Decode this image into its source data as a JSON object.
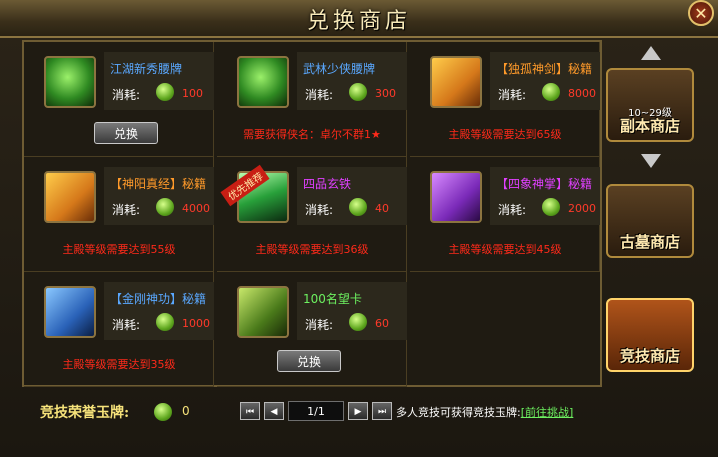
{
  "window": {
    "title": "兑换商店",
    "close_label": "✕"
  },
  "cost_label": "消耗:",
  "items": [
    {
      "name": "江湖新秀腰牌",
      "name_color": "#5aa8ff",
      "cost": "100",
      "requirement": "",
      "button": "兑换",
      "icon": "jade-waist-token-icon"
    },
    {
      "name": "武林少侠腰牌",
      "name_color": "#5aa8ff",
      "cost": "300",
      "requirement": "需要获得侠名：卓尔不群1★",
      "button": "",
      "icon": "jade-waist-token-icon"
    },
    {
      "name": "【独孤神剑】秘籍",
      "name_color": "#ff9a2a",
      "cost": "8000",
      "requirement": "主殿等级需要达到65级",
      "button": "",
      "icon": "orange-book-icon"
    },
    {
      "name": "【神阳真经】秘籍",
      "name_color": "#ff9a2a",
      "cost": "4000",
      "requirement": "主殿等级需要达到55级",
      "button": "",
      "icon": "orange-book-icon"
    },
    {
      "name": "四品玄铁",
      "name_color": "#e040ff",
      "cost": "40",
      "requirement": "主殿等级需要达到36级",
      "button": "",
      "icon": "green-crystal-icon",
      "badge": "优先推荐"
    },
    {
      "name": "【四象神掌】秘籍",
      "name_color": "#e040ff",
      "cost": "2000",
      "requirement": "主殿等级需要达到45级",
      "button": "",
      "icon": "purple-book-icon"
    },
    {
      "name": "【金刚神功】秘籍",
      "name_color": "#5aa8ff",
      "cost": "1000",
      "requirement": "主殿等级需要达到35级",
      "button": "",
      "icon": "blue-book-icon"
    },
    {
      "name": "100名望卡",
      "name_color": "#6df060",
      "cost": "60",
      "requirement": "",
      "button": "兑换",
      "icon": "fame-card-icon"
    }
  ],
  "tabs": [
    {
      "label": "副本商店",
      "sub": "10~29级"
    },
    {
      "label": "古墓商店",
      "sub": ""
    },
    {
      "label": "竞技商店",
      "sub": ""
    }
  ],
  "footer": {
    "honor_label": "竞技荣誉玉牌:",
    "honor_value": "0",
    "page": "1/1",
    "first": "⏮",
    "prev": "◀",
    "next": "▶",
    "last": "⏭",
    "hint": "多人竞技可获得竞技玉牌:",
    "hint_link": "[前往挑战]"
  },
  "colors": {
    "cost": "#ff3a2a",
    "requirement": "#ff2a1a",
    "honor": "#f6e27a"
  }
}
